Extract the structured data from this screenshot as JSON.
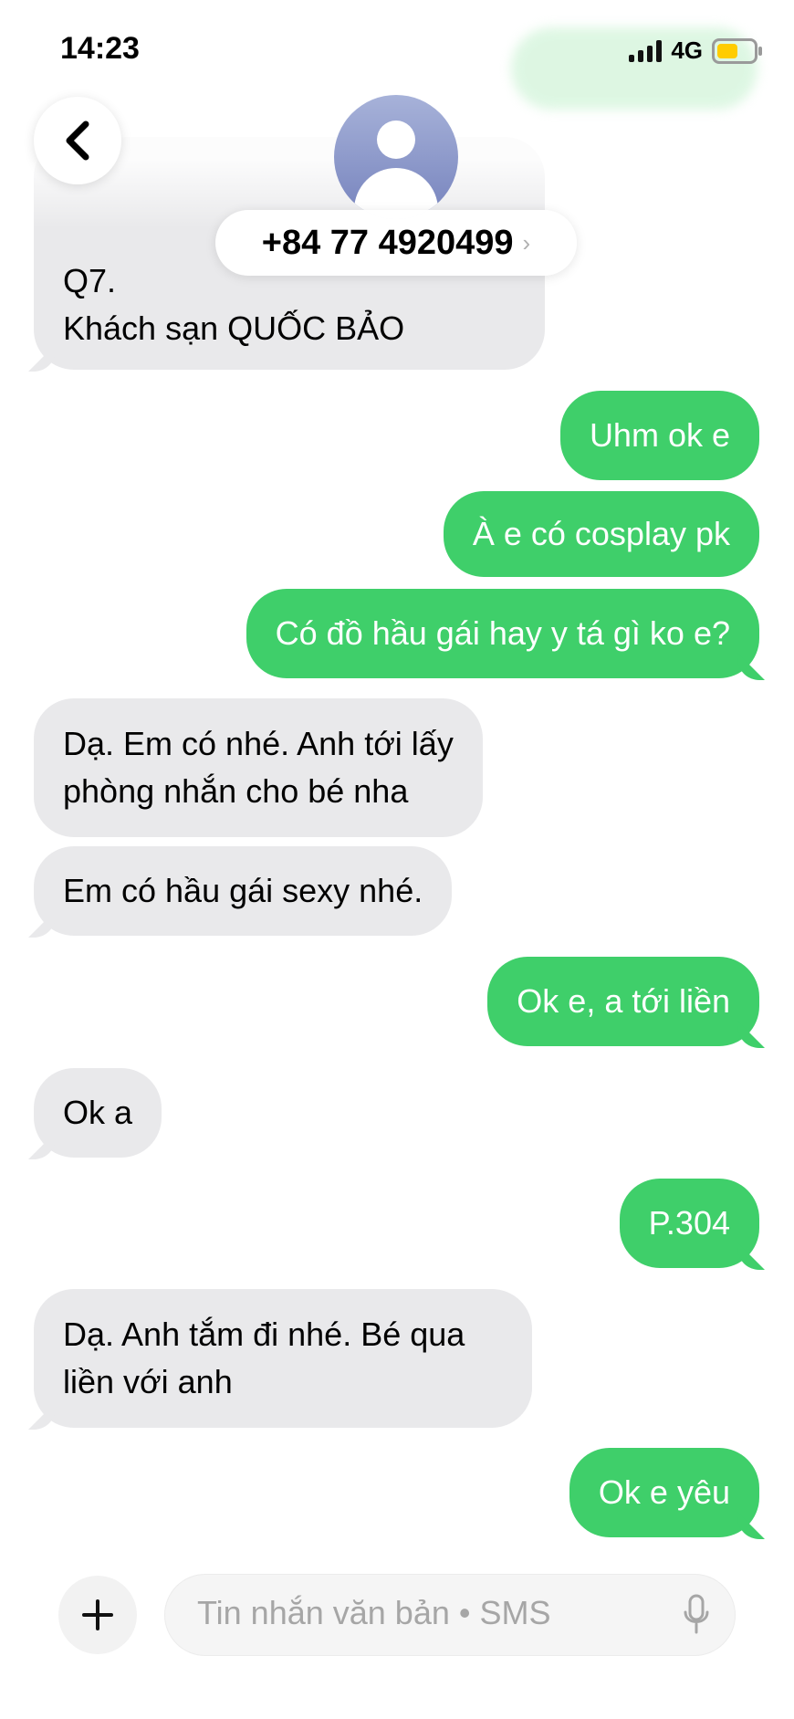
{
  "status_bar": {
    "time": "14:23",
    "network": "4G"
  },
  "header": {
    "contact": "+84 77 4920499",
    "chevron": "›"
  },
  "messages": [
    {
      "dir": "in",
      "lines": [
        "Khách sạn QUỐC BẢO"
      ],
      "partial_lines": [
        "Q7."
      ]
    },
    {
      "dir": "out",
      "lines": [
        "Uhm ok e"
      ]
    },
    {
      "dir": "out",
      "lines": [
        "À e có cosplay pk"
      ]
    },
    {
      "dir": "out",
      "lines": [
        "Có đồ hầu gái hay y tá gì ko e?"
      ]
    },
    {
      "dir": "in",
      "lines": [
        "Dạ. Em có nhé. Anh tới lấy",
        "phòng nhắn cho bé nha"
      ]
    },
    {
      "dir": "in",
      "lines": [
        "Em có hầu gái sexy nhé."
      ]
    },
    {
      "dir": "out",
      "lines": [
        "Ok e, a tới liền"
      ]
    },
    {
      "dir": "in",
      "lines": [
        "Ok a"
      ]
    },
    {
      "dir": "out",
      "lines": [
        "P.304"
      ]
    },
    {
      "dir": "in",
      "lines": [
        "Dạ. Anh tắm đi nhé. Bé qua",
        "liền với anh"
      ]
    },
    {
      "dir": "out",
      "lines": [
        "Ok e yêu"
      ]
    }
  ],
  "composer": {
    "placeholder": "Tin nhắn văn bản • SMS",
    "plus": "+"
  },
  "colors": {
    "outgoing": "#3fcf6a",
    "incoming": "#e9e9eb",
    "battery": "#ffcc00"
  },
  "icons": [
    "back-chevron-icon",
    "avatar-icon",
    "signal-icon",
    "battery-icon",
    "plus-icon",
    "microphone-icon"
  ]
}
